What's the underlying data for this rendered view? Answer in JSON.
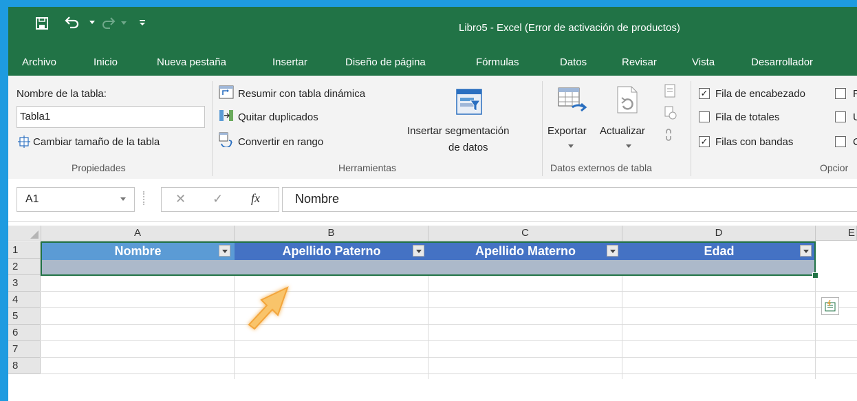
{
  "title_bar": {
    "document_title": "Libro5 - Excel (Error de activación de productos)",
    "quick_access": [
      "save-icon",
      "undo-icon",
      "redo-icon",
      "customize-icon"
    ]
  },
  "tabs": [
    "Archivo",
    "Inicio",
    "Nueva pestaña",
    "Insertar",
    "Diseño de página",
    "Fórmulas",
    "Datos",
    "Revisar",
    "Vista",
    "Desarrollador"
  ],
  "ribbon": {
    "propiedades": {
      "table_name_label": "Nombre de la tabla:",
      "table_name_value": "Tabla1",
      "resize_label": "Cambiar tamaño de la tabla",
      "group_label": "Propiedades"
    },
    "herramientas": {
      "pivot_label": "Resumir con tabla dinámica",
      "dupes_label": "Quitar duplicados",
      "convert_label": "Convertir en rango",
      "slicer_line1": "Insertar segmentación",
      "slicer_line2": "de datos",
      "group_label": "Herramientas"
    },
    "datos_externos": {
      "export_label": "Exportar",
      "refresh_label": "Actualizar",
      "group_label": "Datos externos de tabla"
    },
    "opciones": {
      "header_row": "Fila de encabezado",
      "header_row_checked": true,
      "total_row": "Fila de totales",
      "total_row_checked": false,
      "banded_rows": "Filas con bandas",
      "banded_rows_checked": true,
      "group_label": "Opcior",
      "check_glyph": "✓",
      "truncated_1": "F",
      "truncated_2": "U",
      "truncated_3": "C"
    }
  },
  "formula_bar": {
    "cell_ref": "A1",
    "fx": "fx",
    "cancel": "✕",
    "enter": "✓",
    "content": "Nombre"
  },
  "grid": {
    "columns": [
      "A",
      "B",
      "C",
      "D",
      "E"
    ],
    "rows": [
      "1",
      "2",
      "3",
      "4",
      "5",
      "6",
      "7",
      "8"
    ],
    "table_headers": [
      "Nombre",
      "Apellido Paterno",
      "Apellido Materno",
      "Edad"
    ]
  },
  "colors": {
    "excel_green": "#217346",
    "table_header_blue": "#4472c4",
    "selected_header": "#5b9bd5",
    "banded_row": "#acb9ca",
    "frame_blue": "#1e9be0",
    "pointer_arrow": "#f9c46a"
  }
}
